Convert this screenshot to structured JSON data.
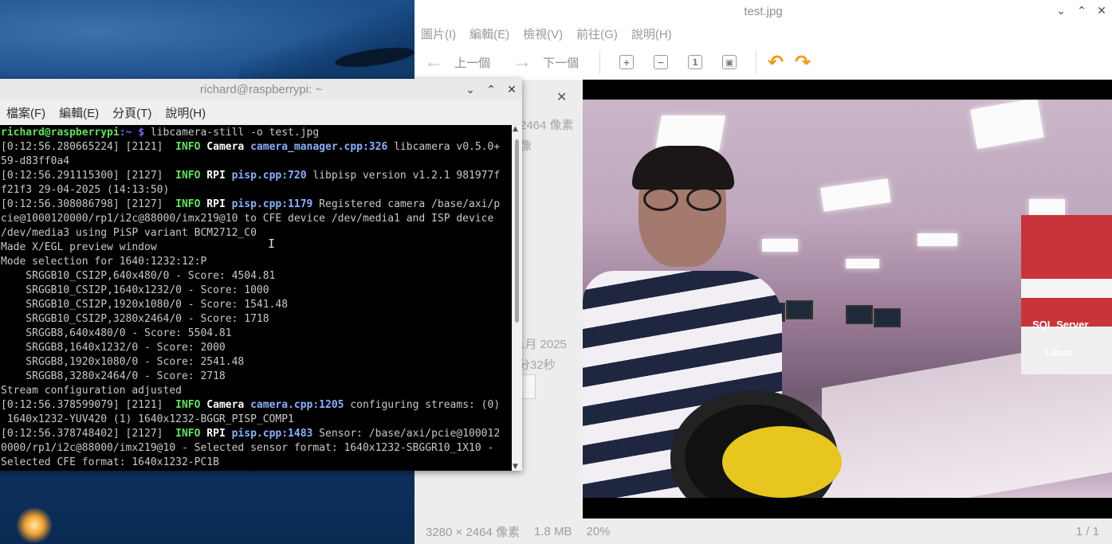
{
  "viewer": {
    "title": "test.jpg",
    "menu": [
      "圖片(I)",
      "編輯(E)",
      "檢視(V)",
      "前往(G)",
      "說明(H)"
    ],
    "toolbar": {
      "prev_label": "上一個",
      "next_label": "下一個"
    },
    "info_panel": {
      "visible_fragments": [
        "2464 像素",
        "像",
        "1月 2025",
        "分32秒"
      ]
    },
    "photo_text": [
      "SQL Server",
      "Linux"
    ],
    "status": {
      "dimensions": "3280 × 2464 像素",
      "size": "1.8 MB",
      "zoom": "20%",
      "pages": "1 / 1"
    }
  },
  "terminal": {
    "title": "richard@raspberrypi: ~",
    "menu": [
      "檔案(F)",
      "編輯(E)",
      "分頁(T)",
      "說明(H)"
    ],
    "prompt": {
      "user": "richard@raspberrypi",
      "path": ":~ $",
      "command": " libcamera-still -o test.jpg"
    },
    "lines": [
      {
        "pre": "[0:12:56.280665224] [2121]  ",
        "lvl": "INFO",
        "comp": " Camera ",
        "src": "camera_manager.cpp:326",
        "rest": " libcamera v0.5.0+"
      },
      {
        "text": "59-d83ff0a4"
      },
      {
        "pre": "[0:12:56.291115300] [2127]  ",
        "lvl": "INFO",
        "comp": " RPI ",
        "src": "pisp.cpp:720",
        "rest": " libpisp version v1.2.1 981977f"
      },
      {
        "text": "f21f3 29-04-2025 (14:13:50)"
      },
      {
        "pre": "[0:12:56.308086798] [2127]  ",
        "lvl": "INFO",
        "comp": " RPI ",
        "src": "pisp.cpp:1179",
        "rest": " Registered camera /base/axi/p"
      },
      {
        "text": "cie@1000120000/rp1/i2c@88000/imx219@10 to CFE device /dev/media1 and ISP device"
      },
      {
        "text": "/dev/media3 using PiSP variant BCM2712_C0"
      },
      {
        "text": "Made X/EGL preview window"
      },
      {
        "text": "Mode selection for 1640:1232:12:P"
      },
      {
        "text": "    SRGGB10_CSI2P,640x480/0 - Score: 4504.81"
      },
      {
        "text": "    SRGGB10_CSI2P,1640x1232/0 - Score: 1000"
      },
      {
        "text": "    SRGGB10_CSI2P,1920x1080/0 - Score: 1541.48"
      },
      {
        "text": "    SRGGB10_CSI2P,3280x2464/0 - Score: 1718"
      },
      {
        "text": "    SRGGB8,640x480/0 - Score: 5504.81"
      },
      {
        "text": "    SRGGB8,1640x1232/0 - Score: 2000"
      },
      {
        "text": "    SRGGB8,1920x1080/0 - Score: 2541.48"
      },
      {
        "text": "    SRGGB8,3280x2464/0 - Score: 2718"
      },
      {
        "text": "Stream configuration adjusted"
      },
      {
        "pre": "[0:12:56.378599079] [2121]  ",
        "lvl": "INFO",
        "comp": " Camera ",
        "src": "camera.cpp:1205",
        "rest": " configuring streams: (0)"
      },
      {
        "text": " 1640x1232-YUV420 (1) 1640x1232-BGGR_PISP_COMP1"
      },
      {
        "pre": "[0:12:56.378748402] [2127]  ",
        "lvl": "INFO",
        "comp": " RPI ",
        "src": "pisp.cpp:1483",
        "rest": " Sensor: /base/axi/pcie@100012"
      },
      {
        "text": "0000/rp1/i2c@88000/imx219@10 - Selected sensor format: 1640x1232-SBGGR10_1X10 -"
      },
      {
        "text": "Selected CFE format: 1640x1232-PC1B"
      }
    ]
  }
}
